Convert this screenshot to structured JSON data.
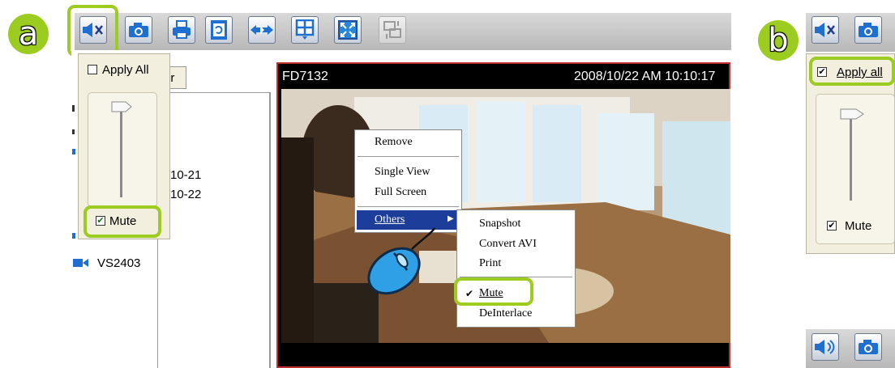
{
  "badges": {
    "a": "a",
    "b": "b"
  },
  "toolbar": {
    "buttons": [
      {
        "name": "mute",
        "icon": "speaker-mute-icon"
      },
      {
        "name": "snapshot",
        "icon": "camera-icon"
      },
      {
        "name": "print",
        "icon": "printer-icon"
      },
      {
        "name": "deinterlace",
        "icon": "refresh-film-icon"
      },
      {
        "name": "toggle",
        "icon": "arrows-icon"
      },
      {
        "name": "layout",
        "icon": "grid-layout-icon"
      },
      {
        "name": "full_screen",
        "icon": "fullscreen-icon"
      },
      {
        "name": "connect",
        "icon": "network-icon"
      }
    ]
  },
  "volume_panel_a": {
    "apply_all": "Apply All",
    "mute": "Mute",
    "mute_checked": true,
    "apply_all_checked": false
  },
  "left_list": {
    "tab_fragment": "er",
    "items": [
      "10-21",
      "10-22"
    ],
    "device": "VS2403"
  },
  "video": {
    "camera_name": "FD7132",
    "timestamp": "2008/10/22 AM 10:10:17"
  },
  "context_menu": {
    "items": [
      "Remove",
      "Single View",
      "Full Screen",
      "Others"
    ],
    "others_arrow": "▶"
  },
  "sub_menu": {
    "items": [
      "Snapshot",
      "Convert AVI",
      "Print",
      "Mute",
      "DeInterlace"
    ],
    "checked_item": "Mute",
    "check": "✔"
  },
  "volume_panel_b": {
    "apply_all": "Apply all",
    "mute": "Mute",
    "mute_checked": true,
    "apply_all_checked": true
  },
  "colors": {
    "highlight": "#9ccc1f",
    "menu_selected": "#1c3d9a",
    "video_border": "#c03030"
  }
}
